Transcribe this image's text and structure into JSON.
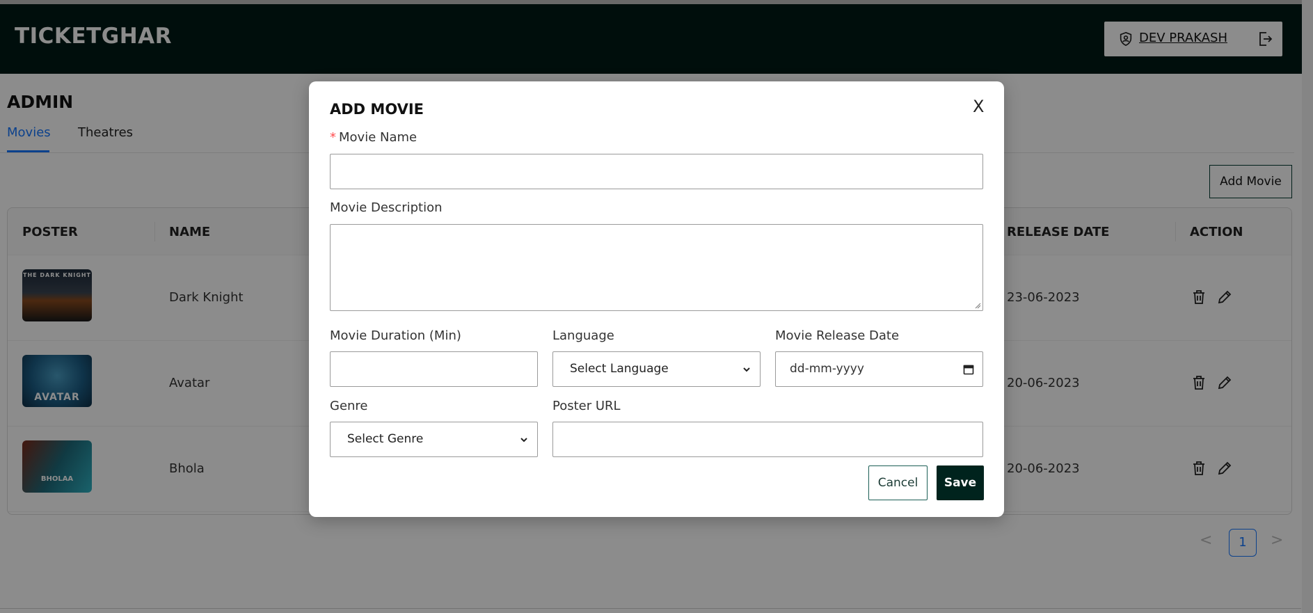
{
  "app": {
    "brand": "TICKETGHAR",
    "user_name": "DEV PRAKASH"
  },
  "admin": {
    "title": "ADMIN",
    "tabs": [
      {
        "label": "Movies",
        "active": true
      },
      {
        "label": "Theatres",
        "active": false
      }
    ],
    "add_movie_label": "Add Movie"
  },
  "table": {
    "columns": {
      "poster": "POSTER",
      "name": "NAME",
      "release_date": "RELEASE DATE",
      "action": "ACTION"
    },
    "rows": [
      {
        "poster_text": "THE DARK KNIGHT",
        "name": "Dark Knight",
        "release_date": "23-06-2023"
      },
      {
        "poster_text": "AVATAR",
        "name": "Avatar",
        "release_date": "20-06-2023"
      },
      {
        "poster_text": "BHOLAA",
        "name": "Bhola",
        "release_date": "20-06-2023"
      }
    ]
  },
  "pagination": {
    "prev": "<",
    "current": "1",
    "next": ">"
  },
  "modal": {
    "title": "ADD MOVIE",
    "close": "X",
    "required_mark": "*",
    "movie_name_label": "Movie Name",
    "movie_name_value": "",
    "description_label": "Movie Description",
    "duration_label": "Movie Duration (Min)",
    "duration_value": "",
    "language_label": "Language",
    "language_selected": "Select Language",
    "release_date_label": "Movie Release Date",
    "release_date_placeholder": "dd-mm-yyyy",
    "genre_label": "Genre",
    "genre_selected": "Select Genre",
    "poster_url_label": "Poster URL",
    "poster_url_value": "",
    "cancel_label": "Cancel",
    "save_label": "Save"
  },
  "colors": {
    "header_bg": "#001b16",
    "accent_blue": "#1677ff",
    "save_bg": "#00231d",
    "required": "#ff4d4f"
  },
  "icons": [
    "user-shield-icon",
    "logout-icon",
    "trash-icon",
    "pencil-icon",
    "chevron-down-icon",
    "calendar-icon",
    "close-icon"
  ]
}
